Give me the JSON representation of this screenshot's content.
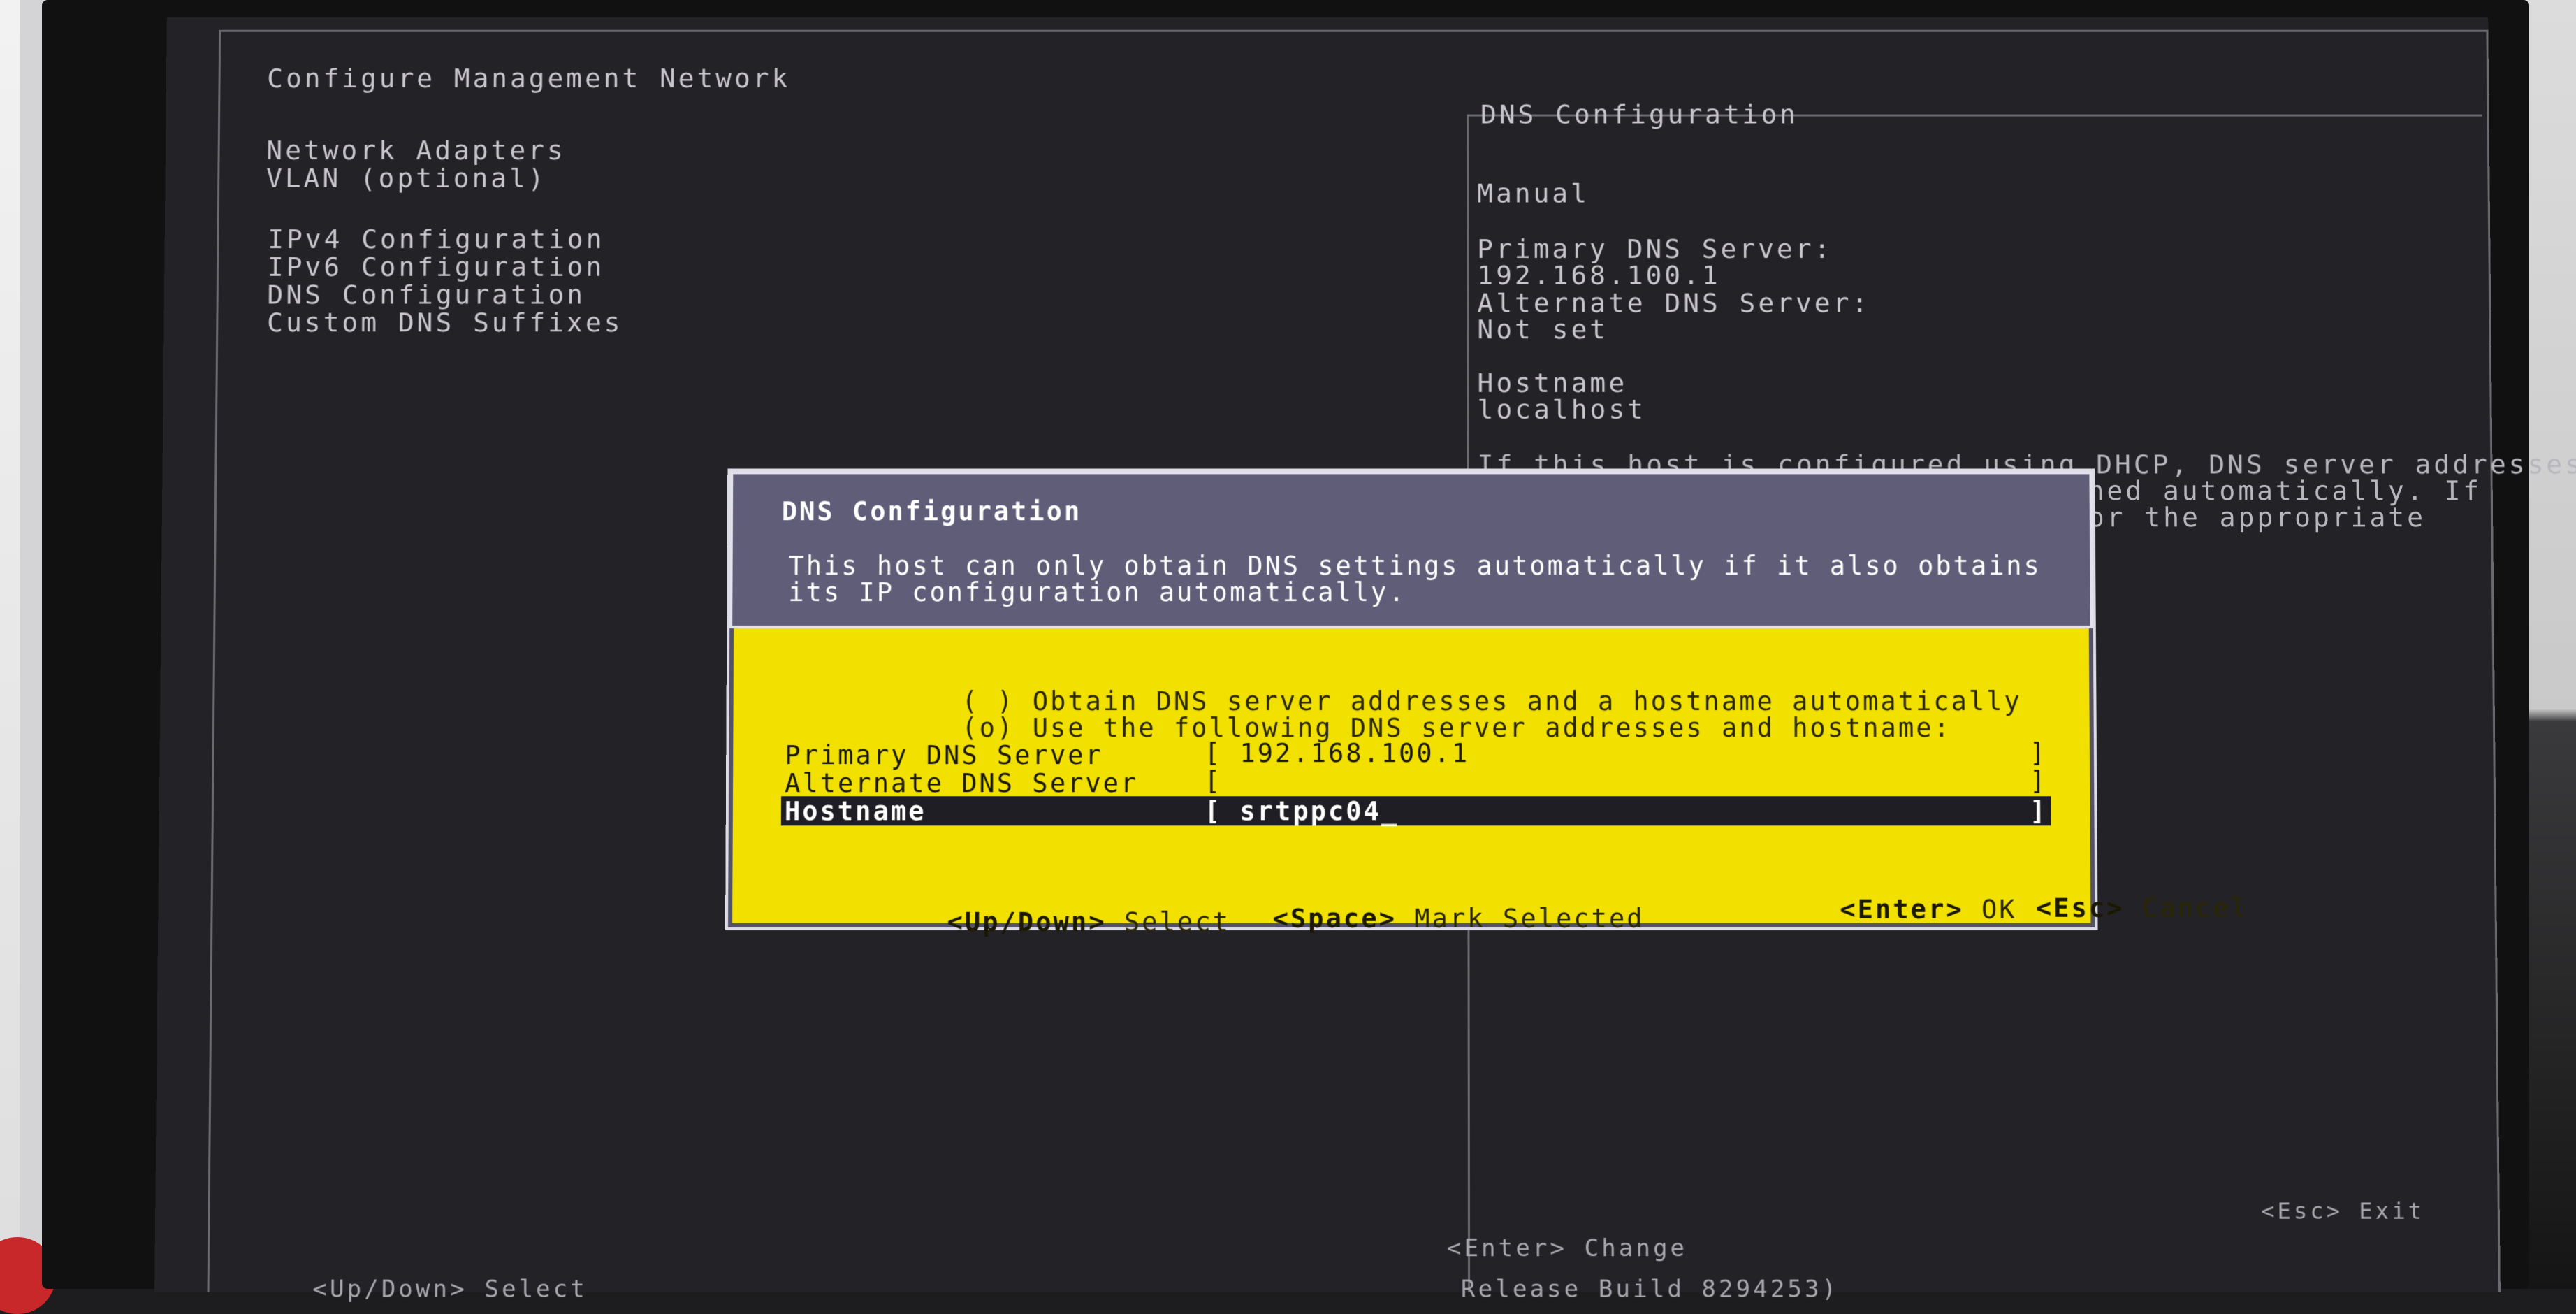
{
  "window": {
    "title": "Configure Management Network",
    "panel_title": "DNS Configuration"
  },
  "menu": {
    "items": [
      {
        "label": "Network Adapters"
      },
      {
        "label": "VLAN (optional)"
      },
      {
        "label": "IPv4 Configuration"
      },
      {
        "label": "IPv6 Configuration"
      },
      {
        "label": "DNS Configuration"
      },
      {
        "label": "Custom DNS Suffixes"
      }
    ]
  },
  "details": {
    "mode": "Manual",
    "primary_label": "Primary DNS Server:",
    "primary_value": "192.168.100.1",
    "alternate_label": "Alternate DNS Server:",
    "alternate_value": "Not set",
    "hostname_label": "Hostname",
    "hostname_value": "localhost",
    "help_lines": [
      "If this host is configured using DHCP, DNS server addresses",
      "ned automatically. If",
      "or the appropriate"
    ]
  },
  "dialog": {
    "title": "DNS Configuration",
    "description_lines": [
      "This host can only obtain DNS settings automatically if it also obtains",
      "its IP configuration automatically."
    ],
    "options": [
      {
        "marker": "( )",
        "label": "Obtain DNS server addresses and a hostname automatically"
      },
      {
        "marker": "(o)",
        "label": "Use the following DNS server addresses and hostname:"
      }
    ],
    "fields": {
      "primary_label": "Primary DNS Server",
      "primary_value": "192.168.100.1",
      "alternate_label": "Alternate DNS Server",
      "alternate_value": "",
      "hostname_label": "Hostname",
      "hostname_value": "srtppc04_"
    },
    "footer": {
      "updown_key": "<Up/Down>",
      "updown_action": "Select",
      "space_key": "<Space>",
      "space_action": "Mark Selected",
      "enter_key": "<Enter>",
      "enter_action": "OK",
      "esc_key": "<Esc>",
      "esc_action": "Cancel"
    }
  },
  "bottom": {
    "esc_hint": "<Esc> Exit",
    "enter_hint": "<Enter> Change",
    "select_hint": "<Up/Down> Select",
    "build_text": "Release Build 8294253)"
  },
  "colors": {
    "screen_bg": "#232226",
    "dialog_bg": "#f1e000",
    "dialog_header_bg": "#5f5d78",
    "selected_field_bg": "#1f1e24"
  }
}
